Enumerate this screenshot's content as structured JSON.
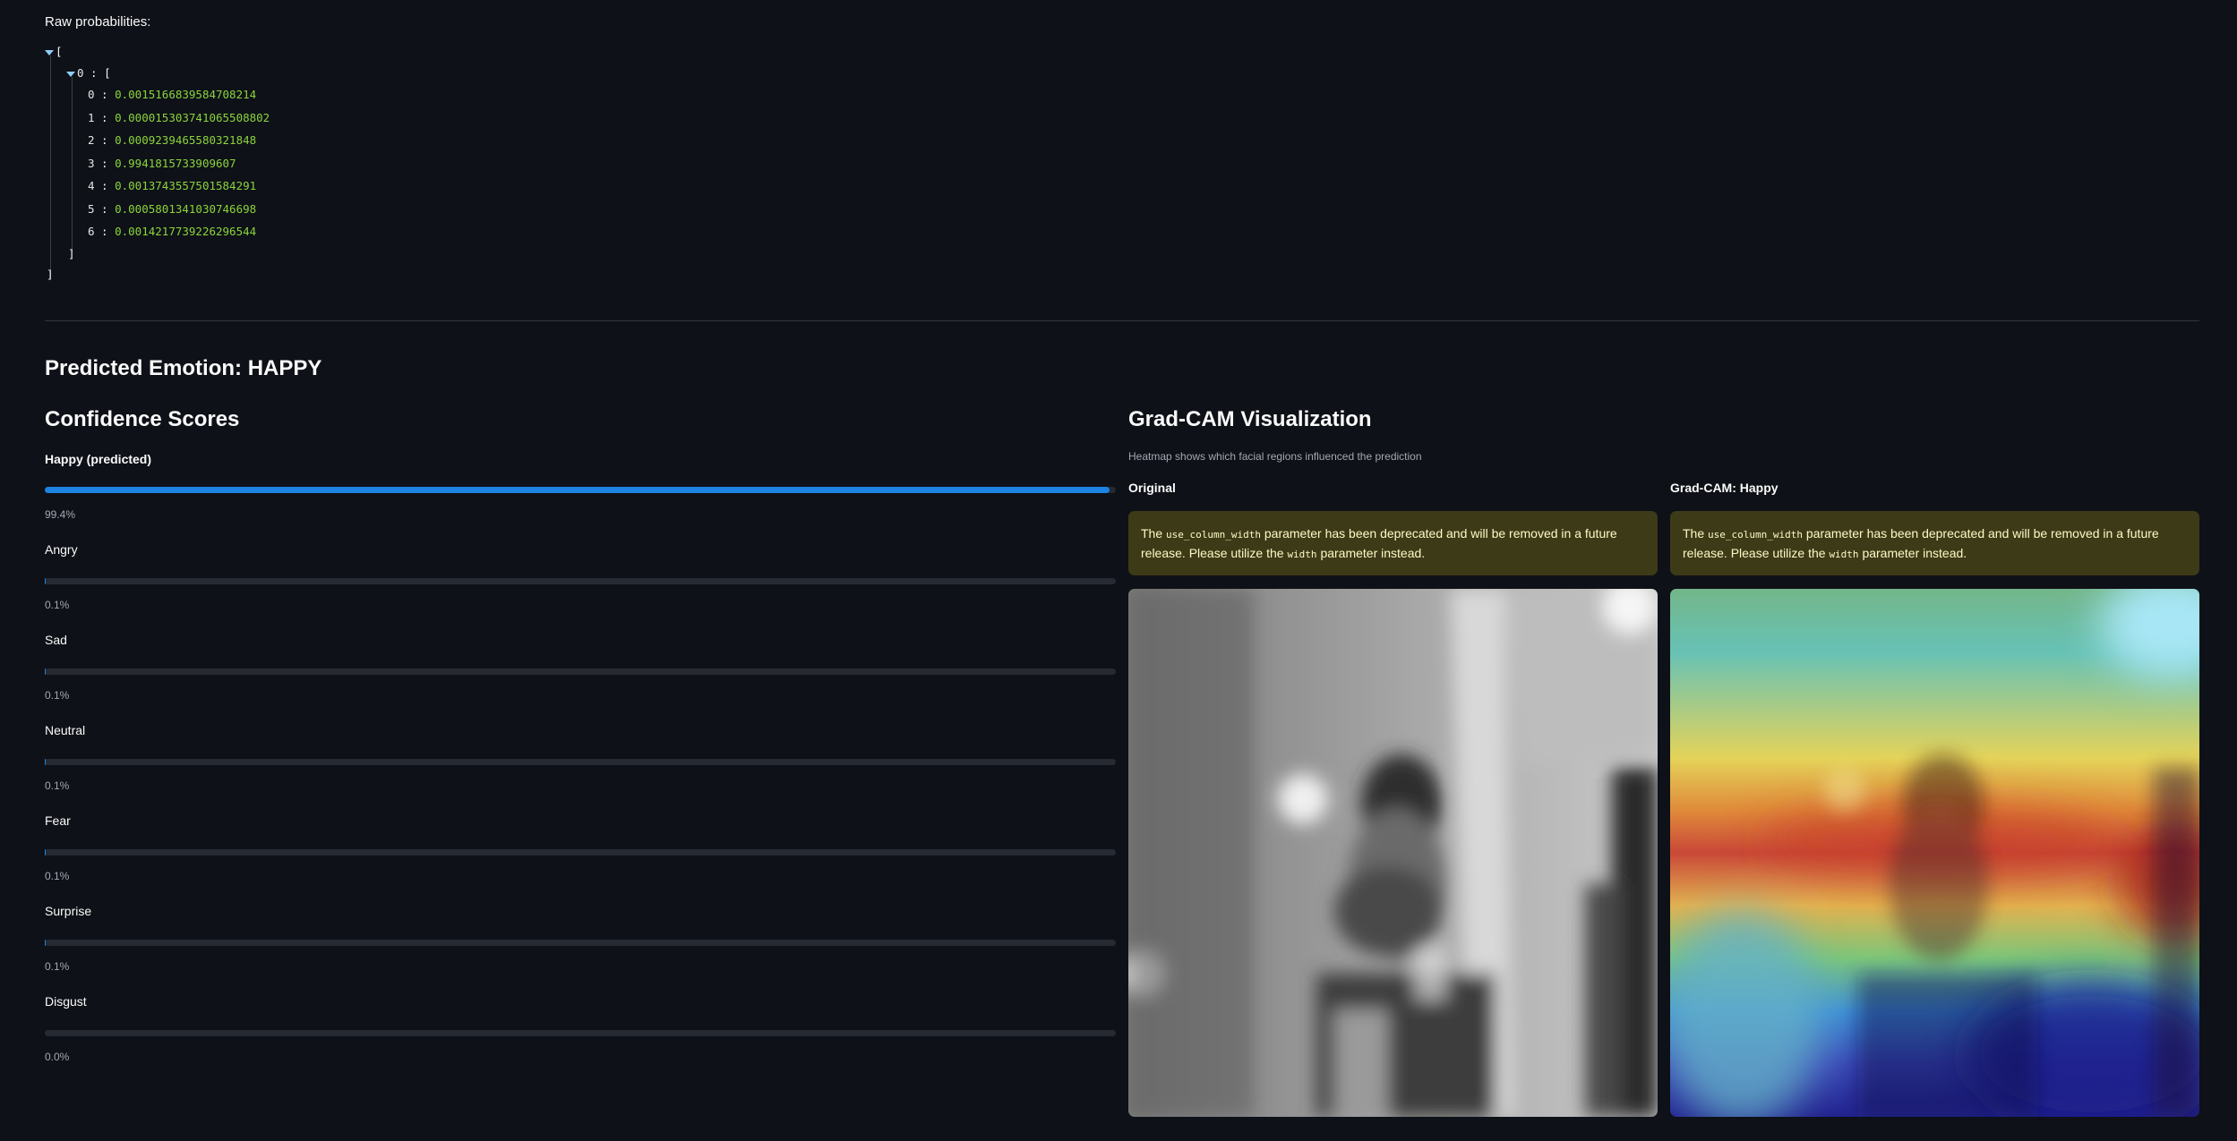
{
  "raw": {
    "label": "Raw probabilities:",
    "outer_open": "[",
    "inner_key": "0",
    "inner_open": "[",
    "inner_close": "]",
    "outer_close": "]",
    "items": [
      {
        "index": "0",
        "value": "0.0015166839584708214"
      },
      {
        "index": "1",
        "value": "0.000015303741065508802"
      },
      {
        "index": "2",
        "value": "0.0009239465580321848"
      },
      {
        "index": "3",
        "value": "0.9941815733909607"
      },
      {
        "index": "4",
        "value": "0.0013743557501584291"
      },
      {
        "index": "5",
        "value": "0.0005801341030746698"
      },
      {
        "index": "6",
        "value": "0.0014217739226296544"
      }
    ]
  },
  "prediction": {
    "title": "Predicted Emotion: HAPPY"
  },
  "confidence": {
    "title": "Confidence Scores",
    "accent_color": "#1c83e1",
    "bars": [
      {
        "label": "Happy (predicted)",
        "value": 0.994,
        "pct": "99.4%"
      },
      {
        "label": "Angry",
        "value": 0.001,
        "pct": "0.1%"
      },
      {
        "label": "Sad",
        "value": 0.001,
        "pct": "0.1%"
      },
      {
        "label": "Neutral",
        "value": 0.001,
        "pct": "0.1%"
      },
      {
        "label": "Fear",
        "value": 0.001,
        "pct": "0.1%"
      },
      {
        "label": "Surprise",
        "value": 0.001,
        "pct": "0.1%"
      },
      {
        "label": "Disgust",
        "value": 0.0,
        "pct": "0.0%"
      }
    ]
  },
  "gradcam": {
    "title": "Grad-CAM Visualization",
    "subtitle": "Heatmap shows which facial regions influenced the prediction",
    "original_label": "Original",
    "heatmap_label": "Grad-CAM: Happy",
    "warning": {
      "pre": "The ",
      "code1": "use_column_width",
      "mid": " parameter has been deprecated and will be removed in a future release. Please utilize the ",
      "code2": "width",
      "post": " parameter instead."
    }
  }
}
